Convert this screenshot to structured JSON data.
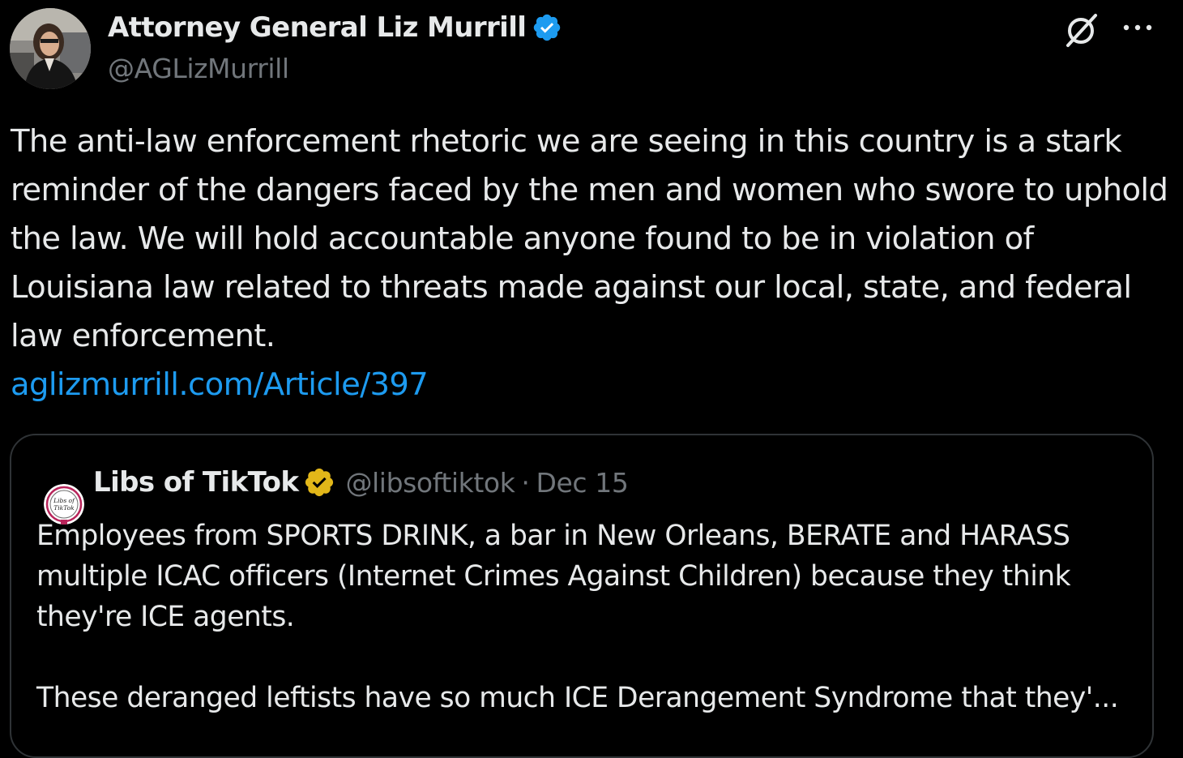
{
  "author": {
    "display_name": "Attorney General Liz Murrill",
    "handle": "@AGLizMurrill",
    "verified": "blue-check-icon"
  },
  "post": {
    "text": "The anti-law enforcement rhetoric we are seeing in this country is a stark reminder of the dangers faced by the men and women who swore to uphold the law. We will hold accountable anyone found to be in violation of Louisiana law related to threats made against our local, state, and federal law enforcement.",
    "link": "aglizmurrill.com/Article/397"
  },
  "quoted": {
    "display_name": "Libs of TikTok",
    "avatar_text_line1": "Libs of",
    "avatar_text_line2": "TikTok",
    "verified": "gold-check-icon",
    "handle": "@libsoftiktok",
    "separator": "·",
    "date": "Dec 15",
    "text_p1": "Employees from SPORTS DRINK, a bar in New Orleans, BERATE and HARASS multiple ICAC officers (Internet Crimes Against Children) because they think they're ICE agents.",
    "text_p2": "These deranged leftists have so much ICE Derangement Syndrome that they'..."
  },
  "icons": {
    "grok": "grok-icon",
    "more": "more-icon"
  },
  "colors": {
    "background": "#000000",
    "text": "#e7e9ea",
    "secondary": "#71767b",
    "link": "#1d9bf0",
    "border": "#2f3336",
    "blue_check": "#1d9bf0",
    "gold_check": "#e2b719"
  }
}
